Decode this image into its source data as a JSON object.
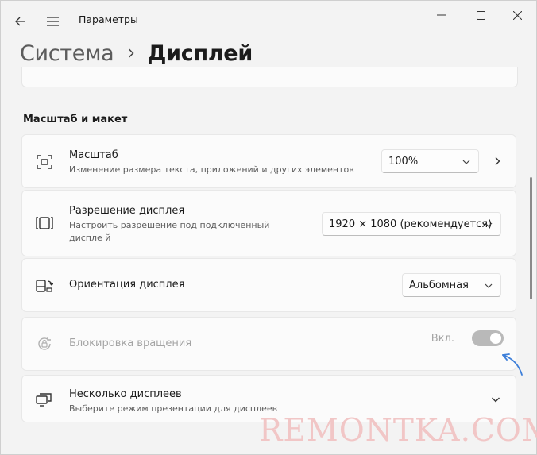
{
  "window": {
    "title": "Параметры"
  },
  "breadcrumb": {
    "parent": "Система",
    "current": "Дисплей"
  },
  "section": {
    "title": "Масштаб и макет"
  },
  "settings": {
    "scale": {
      "title": "Масштаб",
      "subtitle": "Изменение размера текста, приложений и других элементов",
      "value": "100%",
      "icon": "scale-icon"
    },
    "resolution": {
      "title": "Разрешение дисплея",
      "subtitle": "Настроить разрешение под подключенный диспле й",
      "value": "1920 × 1080 (рекомендуется)",
      "icon": "resolution-icon"
    },
    "orientation": {
      "title": "Ориентация дисплея",
      "value": "Альбомная",
      "icon": "orientation-icon"
    },
    "rotation_lock": {
      "title": "Блокировка вращения",
      "state_label": "Вкл.",
      "enabled": false,
      "on": true,
      "icon": "rotation-lock-icon"
    },
    "multiple_displays": {
      "title": "Несколько дисплеев",
      "subtitle": "Выберите режим презентации для дисплеев",
      "icon": "multiple-displays-icon"
    }
  },
  "watermark": {
    "text": "REMONTKA.COM"
  },
  "colors": {
    "background": "#f3f3f3",
    "card": "#fbfbfb",
    "accent_annotation": "#3d7fd9",
    "toggle_disabled": "#b9b9b9",
    "watermark": "#f1c6c6"
  }
}
